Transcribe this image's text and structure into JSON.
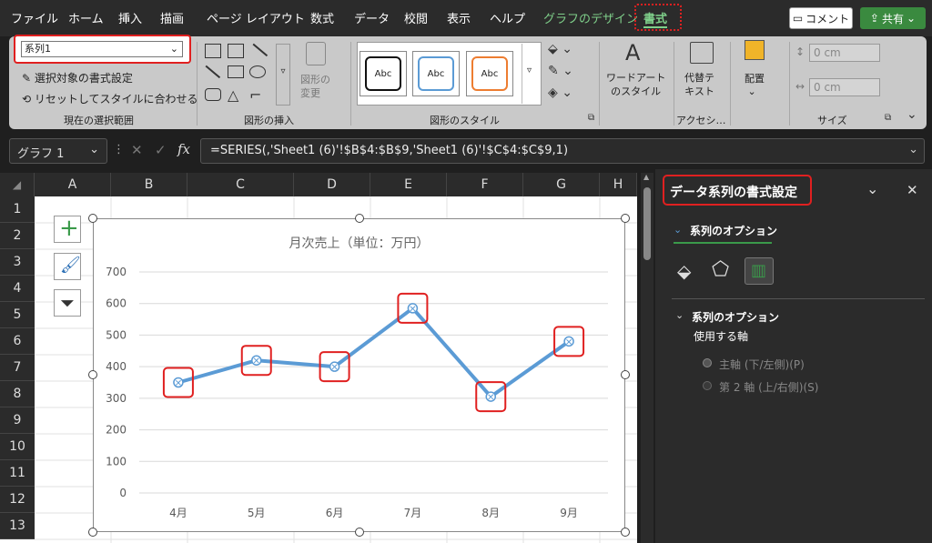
{
  "menu": {
    "tabs": [
      "ファイル",
      "ホーム",
      "挿入",
      "描画",
      "ページ レイアウト",
      "数式",
      "データ",
      "校閲",
      "表示",
      "ヘルプ",
      "グラフのデザイン",
      "書式"
    ],
    "comment_label": "コメント",
    "share_label": "共有"
  },
  "ribbon": {
    "series_select": "系列1",
    "format_selection": "選択対象の書式設定",
    "reset_style": "リセットしてスタイルに合わせる",
    "group_current_selection": "現在の選択範囲",
    "group_insert_shapes": "図形の挿入",
    "change_shape": "図形の\n変更",
    "group_shape_styles": "図形のスタイル",
    "style_sample": "Abc",
    "wordart": "ワードアート\nのスタイル",
    "alt_text": "代替テ\nキスト",
    "group_accessibility": "アクセシ…",
    "arrange": "配置",
    "height_value": "0 cm",
    "width_value": "0 cm",
    "group_size": "サイズ"
  },
  "formula_bar": {
    "name_box": "グラフ 1",
    "fx": "fx",
    "formula": "=SERIES(,'Sheet1 (6)'!$B$4:$B$9,'Sheet1 (6)'!$C$4:$C$9,1)"
  },
  "sheet": {
    "columns": [
      "A",
      "B",
      "C",
      "D",
      "E",
      "F",
      "G",
      "H"
    ],
    "rows": [
      "1",
      "2",
      "3",
      "4",
      "5",
      "6",
      "7",
      "8",
      "9",
      "10",
      "11",
      "12",
      "13"
    ]
  },
  "chart_data": {
    "type": "line",
    "title": "月次売上（単位：万円）",
    "categories": [
      "4月",
      "5月",
      "6月",
      "7月",
      "8月",
      "9月"
    ],
    "values": [
      350,
      420,
      400,
      585,
      305,
      480
    ],
    "ylim": [
      0,
      700
    ],
    "yticks": [
      0,
      100,
      200,
      300,
      400,
      500,
      600,
      700
    ],
    "grid": true,
    "line_color": "#5b9bd5"
  },
  "pane": {
    "title": "データ系列の書式設定",
    "tab_label": "系列のオプション",
    "section_label": "系列のオプション",
    "axis_label": "使用する軸",
    "primary_axis": "主軸 (下/左側)(P)",
    "secondary_axis": "第 2 軸 (上/右側)(S)"
  },
  "colors": {
    "highlight": "#e02020",
    "accent_green": "#107c41"
  }
}
